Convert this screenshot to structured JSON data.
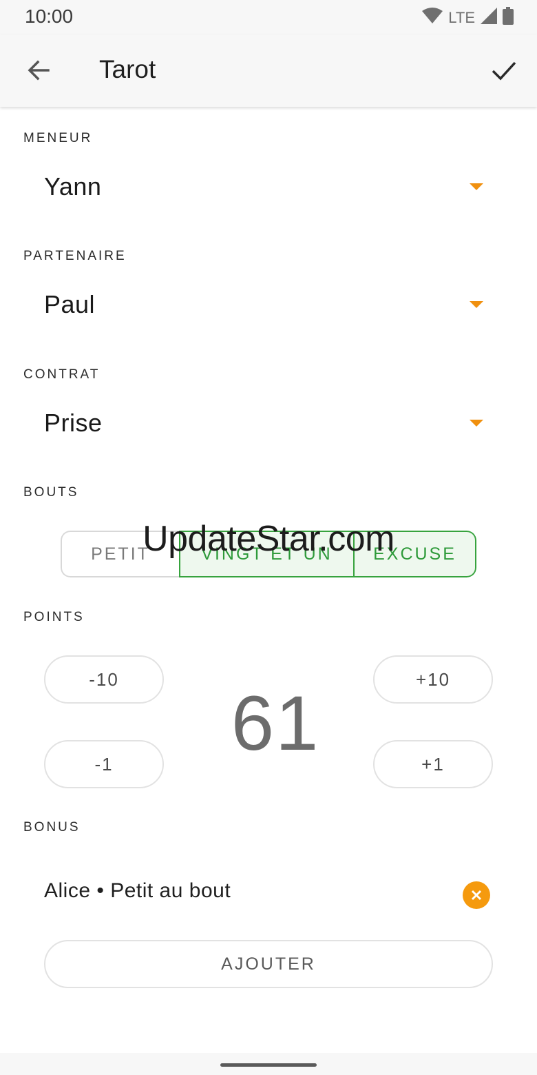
{
  "status_bar": {
    "time": "10:00",
    "network": "LTE"
  },
  "app_bar": {
    "title": "Tarot"
  },
  "meneur": {
    "label": "MENEUR",
    "value": "Yann"
  },
  "partenaire": {
    "label": "PARTENAIRE",
    "value": "Paul"
  },
  "contrat": {
    "label": "CONTRAT",
    "value": "Prise"
  },
  "bouts": {
    "label": "BOUTS",
    "options": [
      {
        "label": "PETIT",
        "selected": false
      },
      {
        "label": "VINGT ET UN",
        "selected": true
      },
      {
        "label": "EXCUSE",
        "selected": true
      }
    ]
  },
  "points": {
    "label": "POINTS",
    "value": "61",
    "minus_ten": "-10",
    "minus_one": "-1",
    "plus_ten": "+10",
    "plus_one": "+1"
  },
  "bonus": {
    "label": "BONUS",
    "items": [
      {
        "text": "Alice • Petit au bout"
      }
    ],
    "add_label": "AJOUTER"
  },
  "watermark": "UpdateStar.com",
  "colors": {
    "accent": "#f59a0e",
    "selected": "#37a33e",
    "selected_bg": "#eef8ee"
  },
  "icons": {
    "back": "arrow-left-icon",
    "confirm": "check-icon",
    "dropdown": "triangle-down-icon",
    "remove": "close-circle-icon"
  }
}
